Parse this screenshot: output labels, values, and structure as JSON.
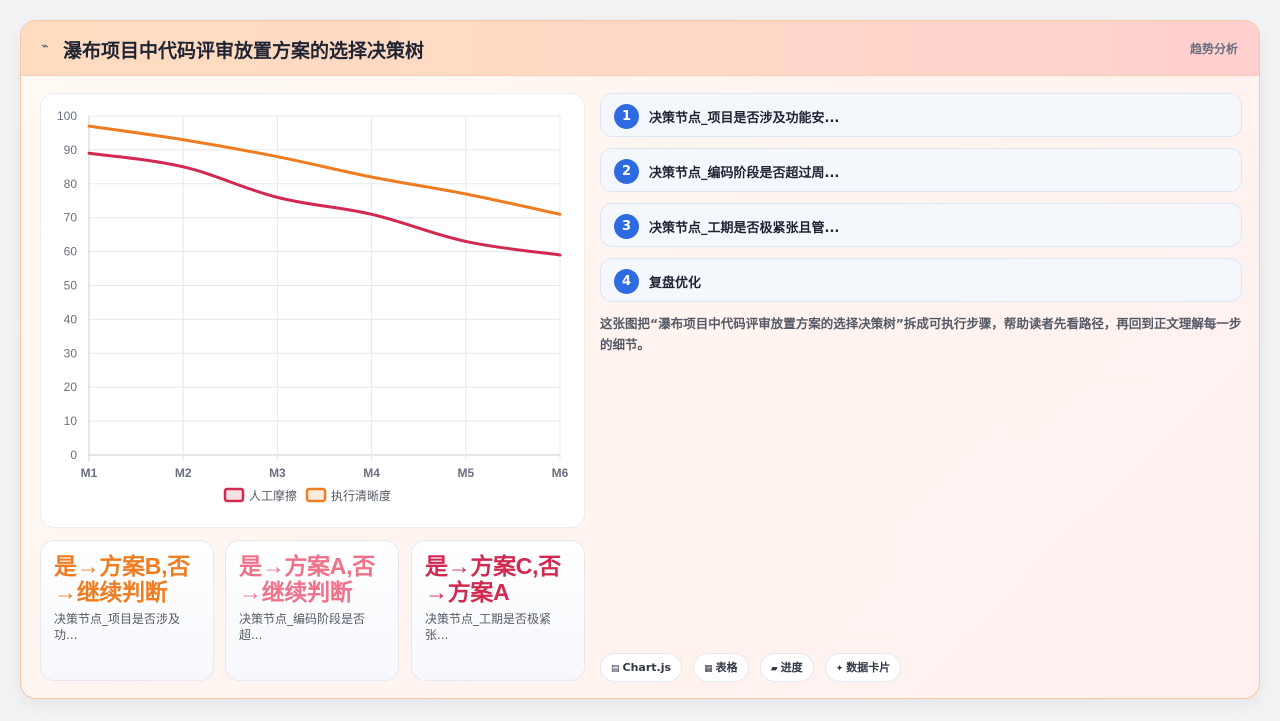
{
  "header": {
    "icon": "chart-line-icon",
    "title": "瀑布项目中代码评审放置方案的选择决策树",
    "tag": "趋势分析"
  },
  "chart_data": {
    "type": "line",
    "categories": [
      "M1",
      "M2",
      "M3",
      "M4",
      "M5",
      "M6"
    ],
    "ylim": [
      0,
      100
    ],
    "yticks": [
      0,
      10,
      20,
      30,
      40,
      50,
      60,
      70,
      80,
      90,
      100
    ],
    "grid": true,
    "legend_position": "bottom",
    "series": [
      {
        "name": "人工摩擦",
        "color": "#d1294f",
        "values": [
          89,
          85,
          76,
          71,
          63,
          59
        ]
      },
      {
        "name": "执行清晰度",
        "color": "#ee7d22",
        "values": [
          97,
          93,
          88,
          82,
          77,
          71
        ]
      }
    ]
  },
  "kpis": [
    {
      "value": "是→方案B,否→继续判断",
      "label": "决策节点_项目是否涉及功...",
      "color": "#ee7d22"
    },
    {
      "value": "是→方案A,否→继续判断",
      "label": "决策节点_编码阶段是否超...",
      "color": "#f0718a"
    },
    {
      "value": "是→方案C,否→方案A",
      "label": "决策节点_工期是否极紧张...",
      "color": "#d1294f"
    }
  ],
  "steps": [
    {
      "num": "1",
      "label": "决策节点_项目是否涉及功能安..."
    },
    {
      "num": "2",
      "label": "决策节点_编码阶段是否超过周..."
    },
    {
      "num": "3",
      "label": "决策节点_工期是否极紧张且管..."
    },
    {
      "num": "4",
      "label": "复盘优化"
    }
  ],
  "description": "这张图把“瀑布项目中代码评审放置方案的选择决策树”拆成可执行步骤，帮助读者先看路径，再回到正文理解每一步的细节。",
  "chips": [
    {
      "icon": "table-icon",
      "label": "Chart.js"
    },
    {
      "icon": "grid-icon",
      "label": "表格"
    },
    {
      "icon": "progress-icon",
      "label": "进度"
    },
    {
      "icon": "sparkle-icon",
      "label": "数据卡片"
    }
  ]
}
